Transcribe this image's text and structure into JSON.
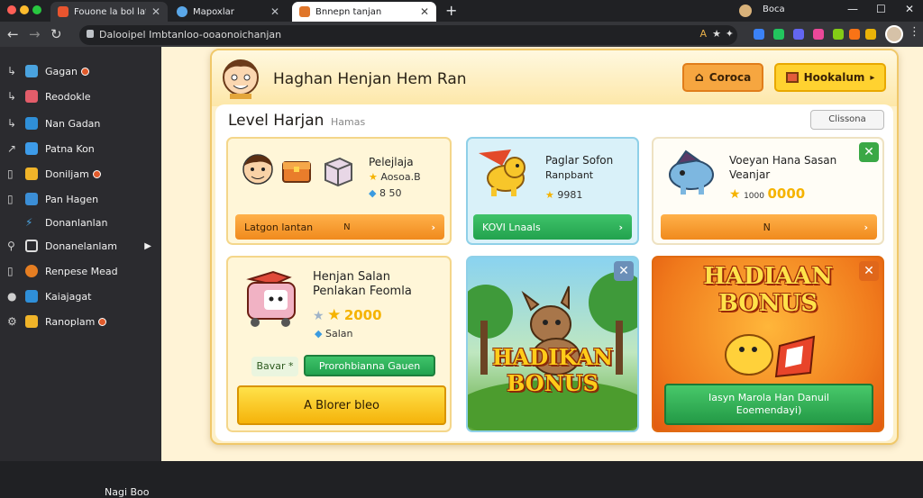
{
  "browser": {
    "tabs": [
      {
        "title": "Fouone la bol lat"
      },
      {
        "title": "Mapoxlar"
      },
      {
        "title": "Bnnepn tanjan"
      }
    ],
    "new_tab": "+",
    "profile": "Boca",
    "win_min": "—",
    "win_max": "☐",
    "win_close": "✕",
    "url": "Dalooipel Imbtanloo-ooaonoichanjan",
    "colors": {
      "tab_active": "#ffffff",
      "accent_orange": "#f6a640",
      "accent_green": "#3aa846"
    }
  },
  "sidebar": {
    "items": [
      {
        "label": "Gagan",
        "icon": "home-icon",
        "badge": true
      },
      {
        "label": "Reodokle",
        "icon": "grid-icon",
        "badge": false
      },
      {
        "label": "Nan Gadan",
        "icon": "doc-icon",
        "badge": false
      },
      {
        "label": "Patna Kon",
        "icon": "image-icon",
        "badge": false
      },
      {
        "label": "Doniljam",
        "icon": "folder-icon",
        "badge": true
      },
      {
        "label": "Pan Hagen",
        "icon": "card-icon",
        "badge": false
      },
      {
        "label": "Donanlanlan",
        "icon": "link-icon",
        "badge": false
      },
      {
        "label": "Donanelanlam",
        "icon": "chat-icon",
        "badge": false,
        "expand": true
      },
      {
        "label": "Renpese Mead",
        "icon": "globe-icon",
        "badge": false
      },
      {
        "label": "Kaiajagat",
        "icon": "check-icon",
        "badge": false
      },
      {
        "label": "Ranoplam",
        "icon": "gear-icon",
        "badge": true
      }
    ],
    "footer": "Nagi Boo"
  },
  "page": {
    "title": "Haghan Henjan Hem Ran",
    "header_btn1": "Coroca",
    "header_btn2": "Hookalum",
    "level_title": "Level Harjan",
    "level_sub": "Hamas",
    "top_button": "Clissona"
  },
  "cards": [
    {
      "title": "Pelejlaja",
      "value": "Aosoa.B",
      "sub": "8 50",
      "button": "Latgon lantan",
      "arrow": "›",
      "button_mark": "N"
    },
    {
      "title": "Paglar Sofon",
      "title2": "Ranpbant",
      "value": "9981",
      "button": "KOVI Lnaals",
      "arrow": "›"
    },
    {
      "title": "Voeyan Hana Sasan",
      "title2": "Veanjar",
      "value": "0000",
      "sub": "1000",
      "button": "N",
      "arrow": "›",
      "close": "✕"
    },
    {
      "title": "Henjan Salan",
      "title2": "Penlakan Feomla",
      "value": "2000",
      "sub": "Salan",
      "tag": "Bavar",
      "tag_mark": "*",
      "green_button": "Prorohbianna Gauen",
      "big_button": "A Blorer bleo"
    },
    {
      "banner": "HADIKAN",
      "banner2": "BONUS",
      "close": "✕"
    },
    {
      "banner": "HADIAAN",
      "banner2": "BONUS",
      "button_line1": "Iasyn Marola Han Danuil",
      "button_line2": "Eoemendayi)",
      "close": "✕"
    }
  ]
}
